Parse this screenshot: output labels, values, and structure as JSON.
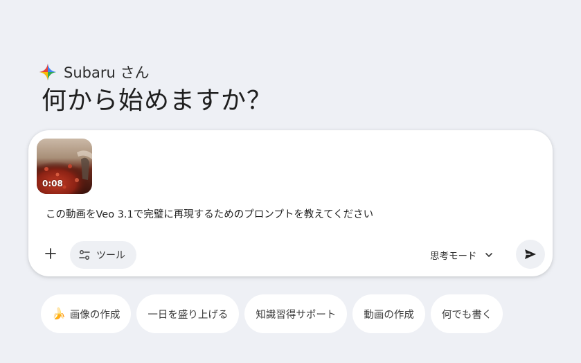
{
  "greeting": {
    "name": "Subaru さん",
    "headline": "何から始めますか？"
  },
  "composer": {
    "attachment": {
      "duration": "0:08"
    },
    "prompt": "この動画をVeo 3.1で完璧に再現するためのプロンプトを教えてください",
    "tools_label": "ツール",
    "mode_label": "思考モード"
  },
  "suggestions": [
    {
      "label": "画像の作成",
      "icon": "🍌"
    },
    {
      "label": "一日を盛り上げる"
    },
    {
      "label": "知識習得サポート"
    },
    {
      "label": "動画の作成"
    },
    {
      "label": "何でも書く"
    }
  ],
  "colors": {
    "background": "#eef0f5",
    "surface": "#ffffff",
    "pill": "#eef0f4",
    "text": "#1f1f1f"
  },
  "icons": {
    "brand": "gemini-sparkle-icon",
    "add": "plus-icon",
    "tools": "tools-sliders-icon",
    "mode_dropdown": "chevron-down-icon",
    "send": "send-arrow-icon"
  }
}
